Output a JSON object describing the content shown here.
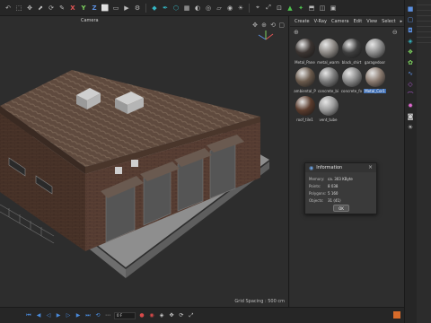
{
  "toolbar": {
    "axis_x": "X",
    "axis_y": "Y",
    "axis_z": "Z"
  },
  "viewport": {
    "camera_label": "Camera",
    "grid_spacing": "Grid Spacing : 500 cm"
  },
  "material_manager": {
    "menu": [
      "Create",
      "V-Ray",
      "Camera",
      "Edit",
      "View",
      "Select"
    ],
    "materials": [
      {
        "label": "Metal_Pane",
        "color": "#3b3431",
        "selected": false
      },
      {
        "label": "metal_warm",
        "color": "#8c8884",
        "selected": false
      },
      {
        "label": "black_shirt",
        "color": "#3d3d3d",
        "selected": false
      },
      {
        "label": "garagedoor",
        "color": "#8b8b8b",
        "selected": false
      },
      {
        "label": "ambiental_P",
        "color": "#6a5a4c",
        "selected": false
      },
      {
        "label": "concrete_bi",
        "color": "#7a7a7a",
        "selected": false
      },
      {
        "label": "concrete_fo",
        "color": "#888888",
        "selected": false
      },
      {
        "label": "Metal_Cor1",
        "color": "#8a7a6f",
        "selected": true
      },
      {
        "label": "roof_tile1",
        "color": "#5b3c2d",
        "selected": false
      },
      {
        "label": "vent_tube",
        "color": "#9a9a9a",
        "selected": false
      }
    ]
  },
  "info_dialog": {
    "title": "Information",
    "rows": [
      {
        "key": "Memory:",
        "value": "ca. 303 KByte"
      },
      {
        "key": "Points:",
        "value": "8 038"
      },
      {
        "key": "Polygons:",
        "value": "5 160"
      },
      {
        "key": "Objects:",
        "value": "31 (41)"
      }
    ],
    "ok_label": "OK"
  },
  "timeline": {
    "frame": "0 F"
  },
  "colors": {
    "accent_blue": "#3f6fb5",
    "axis_x": "#e25555",
    "axis_y": "#7ed35f",
    "axis_z": "#5b8fe0"
  }
}
